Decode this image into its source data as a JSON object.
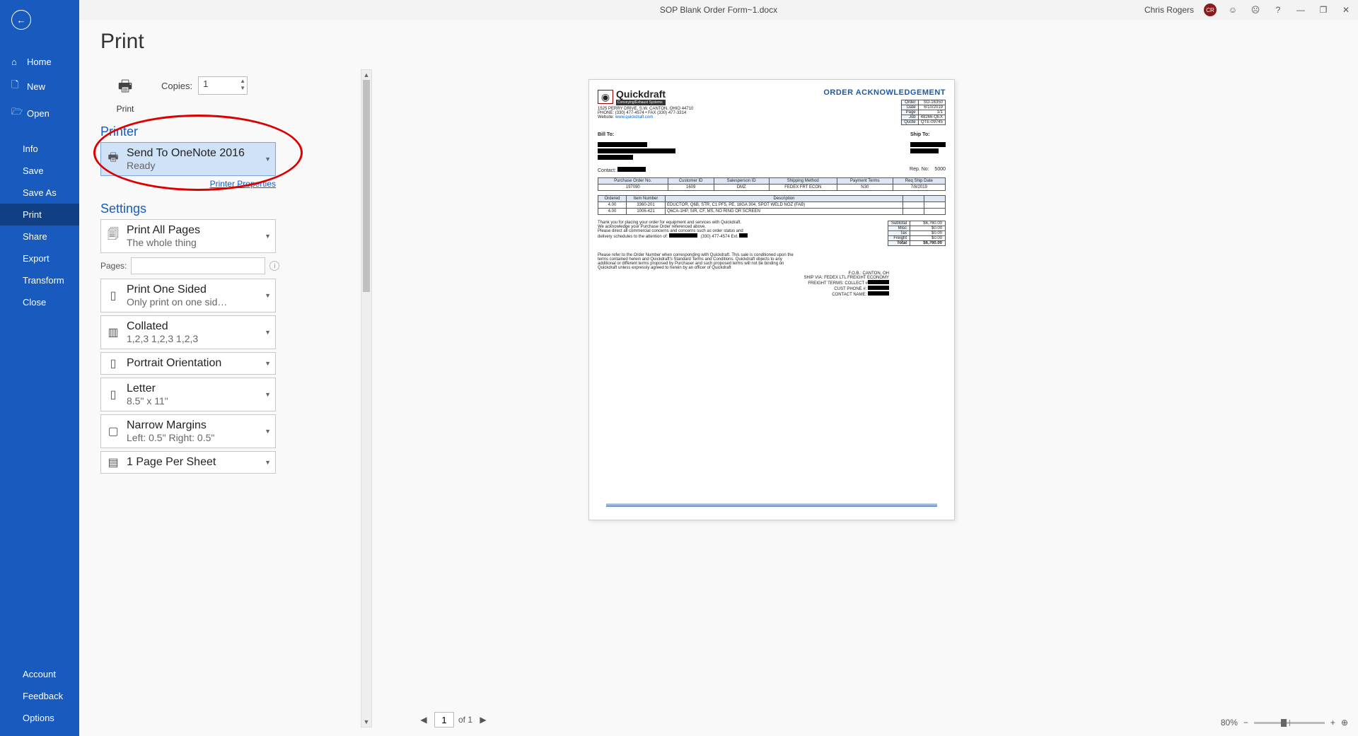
{
  "titlebar": {
    "document": "SOP Blank Order Form~1.docx",
    "user": "Chris Rogers",
    "avatar_initials": "CR"
  },
  "nav": {
    "back": "←",
    "home": "Home",
    "new": "New",
    "open": "Open",
    "info": "Info",
    "save": "Save",
    "saveas": "Save As",
    "print": "Print",
    "share": "Share",
    "export": "Export",
    "transform": "Transform",
    "close": "Close",
    "account": "Account",
    "feedback": "Feedback",
    "options": "Options"
  },
  "heading": "Print",
  "print_btn": "Print",
  "copies_label": "Copies:",
  "copies_value": "1",
  "printer_section": "Printer",
  "printer": {
    "name": "Send To OneNote 2016",
    "status": "Ready"
  },
  "printer_props": "Printer Properties",
  "settings_section": "Settings",
  "dd_pages": {
    "l1": "Print All Pages",
    "l2": "The whole thing"
  },
  "pages_label": "Pages:",
  "dd_sides": {
    "l1": "Print One Sided",
    "l2": "Only print on one sid…"
  },
  "dd_collate": {
    "l1": "Collated",
    "l2": "1,2,3    1,2,3    1,2,3"
  },
  "dd_orient": {
    "l1": "Portrait Orientation"
  },
  "dd_size": {
    "l1": "Letter",
    "l2": "8.5\" x 11\""
  },
  "dd_margin": {
    "l1": "Narrow Margins",
    "l2": "Left:  0.5\"    Right:  0.5\""
  },
  "dd_pps": {
    "l1": "1 Page Per Sheet"
  },
  "page_nav": {
    "current": "1",
    "of": "of 1"
  },
  "zoom": {
    "pct": "80%"
  },
  "doc": {
    "brand": "Quickdraft",
    "brand_sub": "Conveying/Exhaust Systems",
    "ack": "ORDER ACKNOWLEDGEMENT",
    "addr1": "1525 PERRY DRIVE, S.W. CANTON, OHIO 44710",
    "addr2": "PHONE: (330) 477-4574 • FAX (330) 477-3314",
    "addr3_pre": "Website: ",
    "addr3_link": "www.quickdraft.com",
    "meta": {
      "order": "SO-16350",
      "date": "6/10/2019",
      "page": "1/1",
      "job": "48266-QEX",
      "quote": "QTE-09745"
    },
    "billto": "Bill To:",
    "shipto": "Ship To:",
    "contact": "Contact:",
    "repno_label": "Rep. No:",
    "repno": "5000",
    "headers": {
      "po": "Purchase Order No.",
      "cust": "Customer ID",
      "sales": "Salesperson ID",
      "shipm": "Shipping Method",
      "terms": "Payment Terms",
      "reqship": "Req Ship Date"
    },
    "row1": {
      "po": "197090",
      "cust": "1609",
      "sales": "DMZ",
      "shipm": "FEDEX FRT ECON",
      "terms": "N30",
      "reqship": "7/8/2019"
    },
    "headers2": {
      "ordered": "Ordered",
      "item": "Item Number",
      "desc": "Description"
    },
    "lines": [
      {
        "ordered": "4.00",
        "item": "3360-201",
        "desc": "EDUCTOR, Q6B, STR, C1 PF5, PE, 18GA 304, SPOT WELD NOZ (FAB)"
      },
      {
        "ordered": "4.00",
        "item": "1006-421",
        "desc": "Q6CA-1HP, SIR, CF, MS, NO RING OR SCREEN"
      }
    ],
    "thank1": "Thank you for placing your order for equipment and services with Quickdraft.",
    "thank2": "We acknowledge your Purchase Order referenced above.",
    "thank3": "Please direct all commercial concerns and concerns such as order status and",
    "thank4a": "delivery schedules to the attention of:",
    "thank4b": "(330) 477-4574  Ext.",
    "totals": {
      "subtotal_l": "Subtotal",
      "subtotal": "$6,760.00",
      "misc_l": "Misc",
      "misc": "$0.00",
      "tax_l": "Tax",
      "tax": "$0.00",
      "freight_l": "Freight",
      "freight": "$0.00",
      "total_l": "Total",
      "total": "$6,760.00"
    },
    "terms_txt": "Please refer to the Order Number when corresponding with Quickdraft. This sale is conditioned upon the terms contained herein and Quickdraft's Standard Terms and Conditions. Quickdraft objects to any additional or different terms proposed by Purchaser and such proposed terms will not be binding on Quickdraft unless expressly agreed to herein by an officer of Quickdraft",
    "ship1": "F.O.B.: CANTON, OH",
    "ship2": "SHIP VIA: FEDEX LTL FREIGHT ECONOMY",
    "ship3": "FREIGHT TERMS: COLLECT #",
    "ship4": "CUST PHONE #:",
    "ship5": "CONTACT NAME:"
  }
}
